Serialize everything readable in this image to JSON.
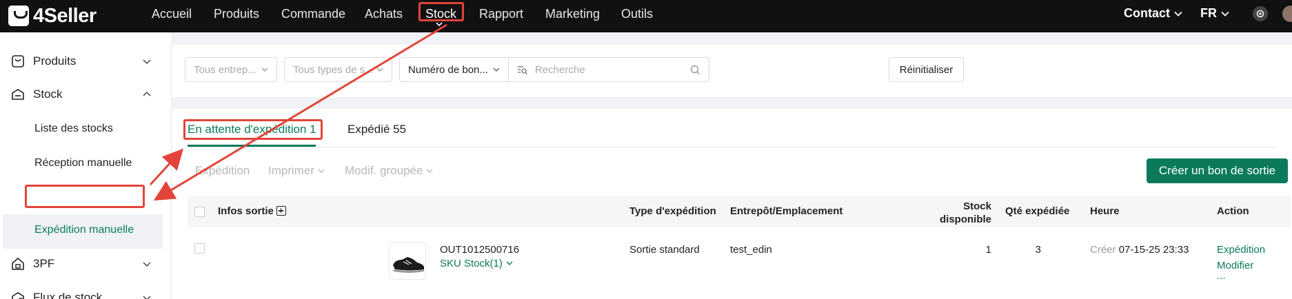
{
  "app": {
    "logo_text": "4Seller"
  },
  "nav": {
    "items": [
      "Accueil",
      "Produits",
      "Commande",
      "Achats",
      "Stock",
      "Rapport",
      "Marketing",
      "Outils"
    ],
    "active": "Stock",
    "contact": "Contact",
    "language": "FR"
  },
  "sidebar": {
    "produits": "Produits",
    "stock": "Stock",
    "stock_sub": [
      "Liste des stocks",
      "Réception manuelle",
      "Expédition manuelle"
    ],
    "tpf": "3PF",
    "flux": "Flux de stock"
  },
  "filters": {
    "warehouse_placeholder": "Tous entrep...",
    "type_placeholder": "Tous types de s...",
    "number_select": "Numéro de bon...",
    "search_placeholder": "Recherche",
    "reset_label": "Réinitialiser"
  },
  "tabs": {
    "pending": "En attente d'expédition 1",
    "shipped": "Expédié 55"
  },
  "toolbar": {
    "expedition": "Expédition",
    "imprimer": "Imprimer",
    "modif_groupee": "Modif. groupée",
    "create_label": "Créer un bon de sortie"
  },
  "table": {
    "headers": {
      "infos": "Infos sortie",
      "type": "Type d'expédition",
      "entrepot": "Entrepôt/Emplacement",
      "stock_line1": "Stock",
      "stock_line2": "disponible",
      "qte": "Qté expédiée",
      "heure": "Heure",
      "action": "Action"
    },
    "rows": [
      {
        "order_no": "OUT1012500716",
        "sku_link": "SKU Stock(1)",
        "type": "Sortie standard",
        "entrepot": "test_edin",
        "stock_dispo": "1",
        "qte": "3",
        "heure_label": "Créer",
        "heure_value": "07-15-25 23:33",
        "action_primary": "Expédition",
        "action_secondary": "Modifier",
        "action_more": "..."
      }
    ]
  },
  "colors": {
    "accent": "#0b7a5a",
    "annotation": "#e2443a",
    "topbar": "#111111"
  }
}
